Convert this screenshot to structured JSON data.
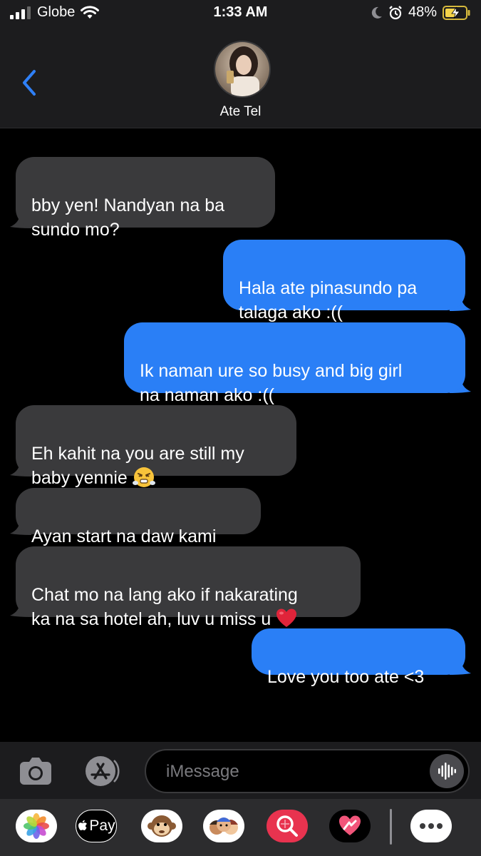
{
  "status_bar": {
    "carrier": "Globe",
    "time": "1:33 AM",
    "battery_percent": "48%"
  },
  "header": {
    "contact_name": "Ate Tel",
    "back_icon": "chevron-left-icon"
  },
  "messages": [
    {
      "direction": "incoming",
      "text": "bby yen! Nandyan na ba\nsundo mo?"
    },
    {
      "direction": "outgoing",
      "text": "Hala ate pinasundo pa\ntalaga ako :(("
    },
    {
      "direction": "outgoing",
      "text": "Ik naman ure so busy and big girl\nna naman ako :(("
    },
    {
      "direction": "incoming",
      "text": "Eh kahit na you are still my\nbaby yennie ",
      "emoji": "huffing-face"
    },
    {
      "direction": "incoming",
      "text": "Ayan start na daw kami"
    },
    {
      "direction": "incoming",
      "text": "Chat mo na lang ako if nakarating\nka na sa hotel ah, luv u miss u ",
      "emoji": "red-heart"
    },
    {
      "direction": "outgoing",
      "text": "Love you too ate <3"
    }
  ],
  "input": {
    "placeholder": "iMessage"
  },
  "app_drawer": {
    "apps": [
      "photos-icon",
      "apple-pay-icon",
      "monkey-memoji-icon",
      "memoji-stickers-icon",
      "image-search-icon",
      "digital-touch-icon",
      "more-icon"
    ],
    "apple_pay_label": "Pay"
  },
  "colors": {
    "incoming_bubble": "#3a3a3c",
    "outgoing_bubble": "#2a7ff6",
    "accent": "#2f80f7"
  }
}
